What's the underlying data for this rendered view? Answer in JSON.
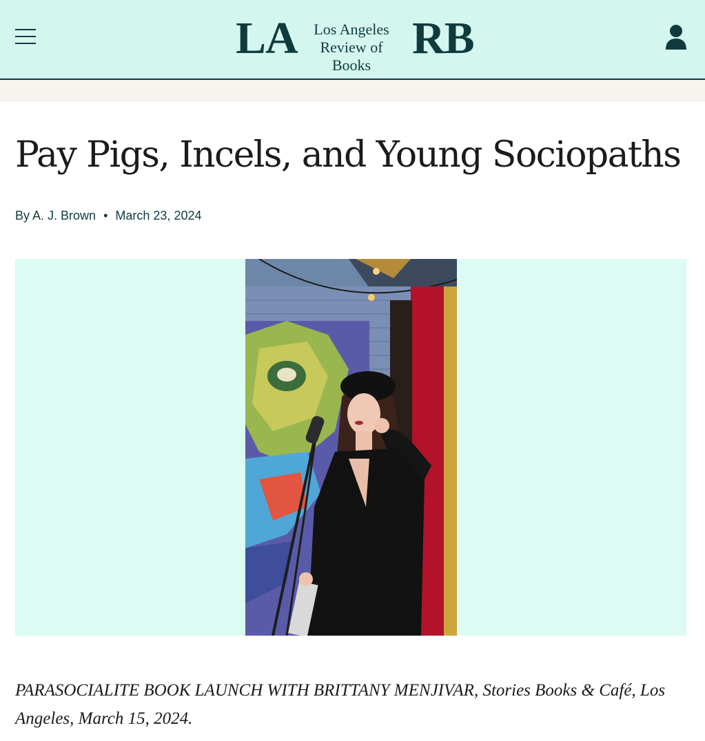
{
  "header": {
    "logo": {
      "left_letters": "LA",
      "line1": "Los Angeles",
      "line2": "Review of Books",
      "right_letters": "RB"
    },
    "menu_icon": "hamburger-menu-icon",
    "account_icon": "user-account-icon"
  },
  "article": {
    "title": "Pay Pigs, Incels, and Young Sociopaths",
    "byline": {
      "prefix": "By",
      "author": "A. J. Brown",
      "separator": "•",
      "date": "March 23, 2024"
    },
    "caption": "PARASOCIALITE BOOK LAUNCH WITH BRITTANY MENJIVAR, Stories Books & Café, Los Angeles, March 15, 2024."
  },
  "colors": {
    "header_bg": "#d4f6ef",
    "brand_dark": "#0f3b3e",
    "hero_bg": "#dcfbf3",
    "beige_band": "#f7f3ee"
  }
}
